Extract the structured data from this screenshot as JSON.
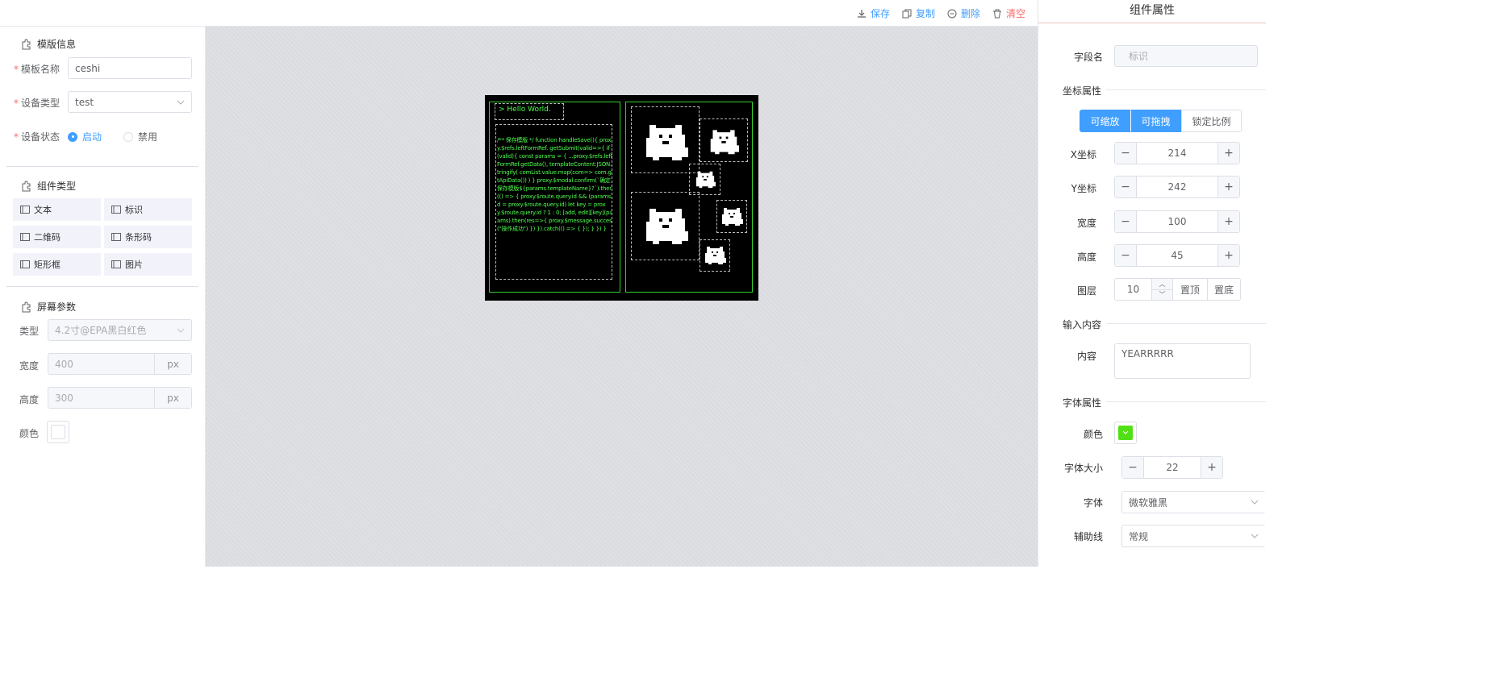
{
  "toolbar": {
    "save_label": "保存",
    "copy_label": "复制",
    "delete_label": "删除",
    "clear_label": "清空"
  },
  "left": {
    "template_section": "模版信息",
    "template_name_label": "模板名称",
    "template_name_value": "ceshi",
    "device_type_label": "设备类型",
    "device_type_value": "test",
    "device_status_label": "设备状态",
    "status_enabled": "启动",
    "status_disabled": "禁用",
    "component_section": "组件类型",
    "components": [
      "文本",
      "标识",
      "二维码",
      "条形码",
      "矩形框",
      "图片"
    ],
    "screen_section": "屏幕参数",
    "type_label": "类型",
    "type_value": "4.2寸@EPA黑白红色",
    "width_label": "宽度",
    "width_value": "400",
    "height_label": "高度",
    "height_value": "300",
    "unit": "px",
    "color_label": "颜色"
  },
  "canvas": {
    "hello_text": "> Hello World.",
    "code_text": "/** 保存模版 */ function handleSave(){ proxy.$refs.leftFormRef. getSubmit(valid=>{ if(valid){ const params = { ...proxy.$refs.leftFormRef.getData(), templateContent:JSON.stringify( comList.value.map(com=> com.getApiData()) ) } proxy.$modal.confirm(`确定保存模版${params.templateName}?`).then(() => { proxy.$route.query.id && (params.id = proxy.$route.query.id) let key = proxy.$route.query.id ? 1 : 0; [add, edit][key](params).then(res=>{ proxy.$message.success(\"操作成功\") }) }).catch(() => { }); } }) }",
    "neon_color": "#4dff4d"
  },
  "right": {
    "title": "组件属性",
    "field_name_label": "字段名",
    "field_name_value": "标识",
    "coord_section": "坐标属性",
    "btn_scalable": "可缩放",
    "btn_draggable": "可拖拽",
    "btn_lock_ratio": "锁定比例",
    "x_label": "X坐标",
    "x_value": "214",
    "y_label": "Y坐标",
    "y_value": "242",
    "w_label": "宽度",
    "w_value": "100",
    "h_label": "高度",
    "h_value": "45",
    "layer_label": "图层",
    "layer_value": "10",
    "to_top": "置顶",
    "to_bottom": "置底",
    "content_section": "输入内容",
    "content_label": "内容",
    "content_value": "YEARRRRR",
    "font_section": "字体属性",
    "color_label": "颜色",
    "font_color": "#52e014",
    "font_size_label": "字体大小",
    "font_size_value": "22",
    "font_label": "字体",
    "font_value": "微软雅黑",
    "guide_label": "辅助线",
    "guide_value": "常规"
  },
  "colors": {
    "primary": "#409eff",
    "danger": "#f56c6c"
  }
}
